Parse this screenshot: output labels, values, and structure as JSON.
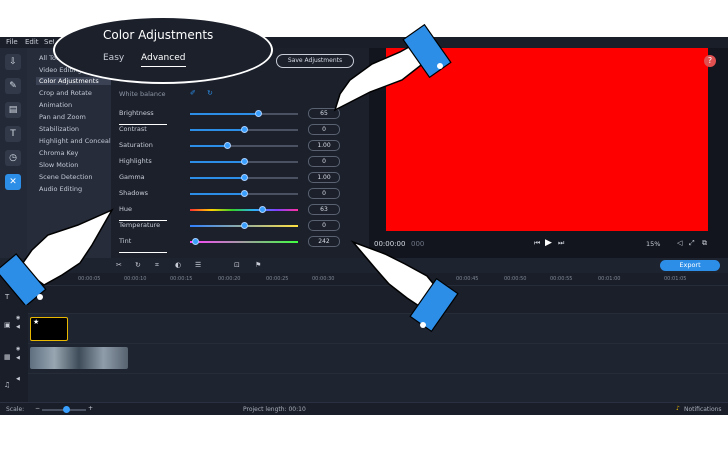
{
  "menu": [
    "File",
    "Edit",
    "Settings"
  ],
  "header": {
    "title": "Color Adjustments",
    "tabs": [
      "Easy",
      "Advanced"
    ],
    "save_label": "Save Adjustments",
    "section_label": "Advanced",
    "white_balance_label": "White balance"
  },
  "categories": [
    "All Tools",
    "Video Editing",
    "Color Adjustments",
    "Crop and Rotate",
    "Animation",
    "Pan and Zoom",
    "Stabilization",
    "Highlight and Conceal",
    "Chroma Key",
    "Slow Motion",
    "Scene Detection",
    "Audio Editing"
  ],
  "adjustments": [
    {
      "label": "Brightness",
      "value": "65",
      "level": 0.63
    },
    {
      "label": "Contrast",
      "value": "0",
      "level": 0.5
    },
    {
      "label": "Saturation",
      "value": "1.00",
      "level": 0.34
    },
    {
      "label": "Highlights",
      "value": "0",
      "level": 0.5
    },
    {
      "label": "Gamma",
      "value": "1.00",
      "level": 0.5
    },
    {
      "label": "Shadows",
      "value": "0",
      "level": 0.5
    },
    {
      "label": "Hue",
      "value": "63",
      "level": 0.67
    },
    {
      "label": "Temperature",
      "value": "0",
      "level": 0.5
    },
    {
      "label": "Tint",
      "value": "242",
      "level": 0.05
    }
  ],
  "preview": {
    "timecode": "00:00:00",
    "timecode_ms": "000",
    "zoom": "15%",
    "frame_color": "#ff0000"
  },
  "timeline": {
    "export_label": "Export",
    "ticks": [
      "00:00:05",
      "00:00:10",
      "00:00:15",
      "00:00:20",
      "00:00:25",
      "00:00:30",
      "00:00:45",
      "00:00:50",
      "00:00:55",
      "00:01:00",
      "00:01:05"
    ]
  },
  "status": {
    "scale_label": "Scale:",
    "project_length": "Project length: 00:10",
    "notifications": "Notifications"
  },
  "colors": {
    "accent": "#2d8ee8",
    "preview_red": "#ff0000",
    "hand_cuff": "#2d8ee8"
  }
}
